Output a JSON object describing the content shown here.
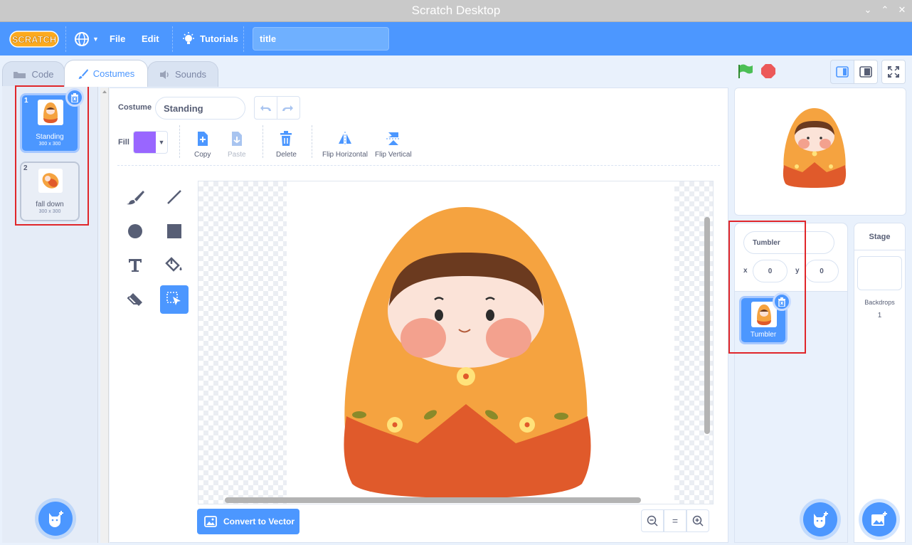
{
  "window": {
    "title": "Scratch Desktop"
  },
  "menu": {
    "logo": "SCRATCH",
    "file": "File",
    "edit": "Edit",
    "tutorials": "Tutorials",
    "project_title": "title"
  },
  "tabs": [
    {
      "label": "Code"
    },
    {
      "label": "Costumes"
    },
    {
      "label": "Sounds"
    }
  ],
  "costumes": [
    {
      "number": "1",
      "name": "Standing",
      "size": "300 x 300",
      "selected": true
    },
    {
      "number": "2",
      "name": "fall down",
      "size": "300 x 300",
      "selected": false
    }
  ],
  "editor": {
    "costume_label": "Costume",
    "costume_name": "Standing",
    "fill_label": "Fill",
    "fill_color": "#9966ff",
    "actions": {
      "copy": "Copy",
      "paste": "Paste",
      "delete": "Delete",
      "flip_h": "Flip Horizontal",
      "flip_v": "Flip Vertical"
    },
    "convert_button": "Convert to Vector",
    "zoom_reset": "="
  },
  "sprite": {
    "name": "Tumbler",
    "x_label": "x",
    "x": "0",
    "y_label": "y",
    "y": "0",
    "tile_name": "Tumbler"
  },
  "stage": {
    "heading": "Stage",
    "backdrops_label": "Backdrops",
    "backdrops_count": "1"
  },
  "colors": {
    "accent": "#4c97ff",
    "highlight": "#e0262a",
    "doll_orange": "#f5a340",
    "doll_red": "#e05a2b"
  }
}
